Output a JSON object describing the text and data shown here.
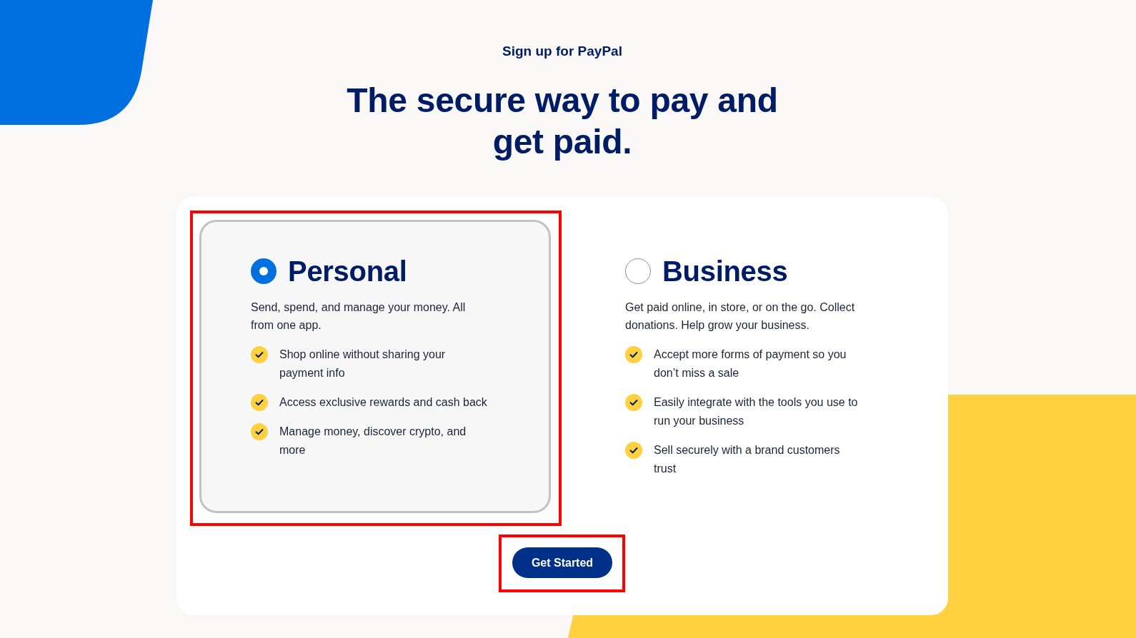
{
  "header": {
    "eyebrow": "Sign up for PayPal",
    "headline": "The secure way to pay and get paid."
  },
  "account_types": [
    {
      "title": "Personal",
      "selected": true,
      "highlighted": true,
      "description": "Send, spend, and manage your money. All from one app.",
      "features": [
        "Shop online without sharing your payment info",
        "Access exclusive rewards and cash back",
        "Manage money, discover crypto, and more"
      ]
    },
    {
      "title": "Business",
      "selected": false,
      "highlighted": false,
      "description": "Get paid online, in store, or on the go. Collect donations. Help grow your business.",
      "features": [
        "Accept more forms of payment so you don’t miss a sale",
        "Easily integrate with the tools you use to run your business",
        "Sell securely with a brand customers trust"
      ]
    }
  ],
  "primary_button": {
    "label": "Get Started",
    "highlighted": true
  }
}
